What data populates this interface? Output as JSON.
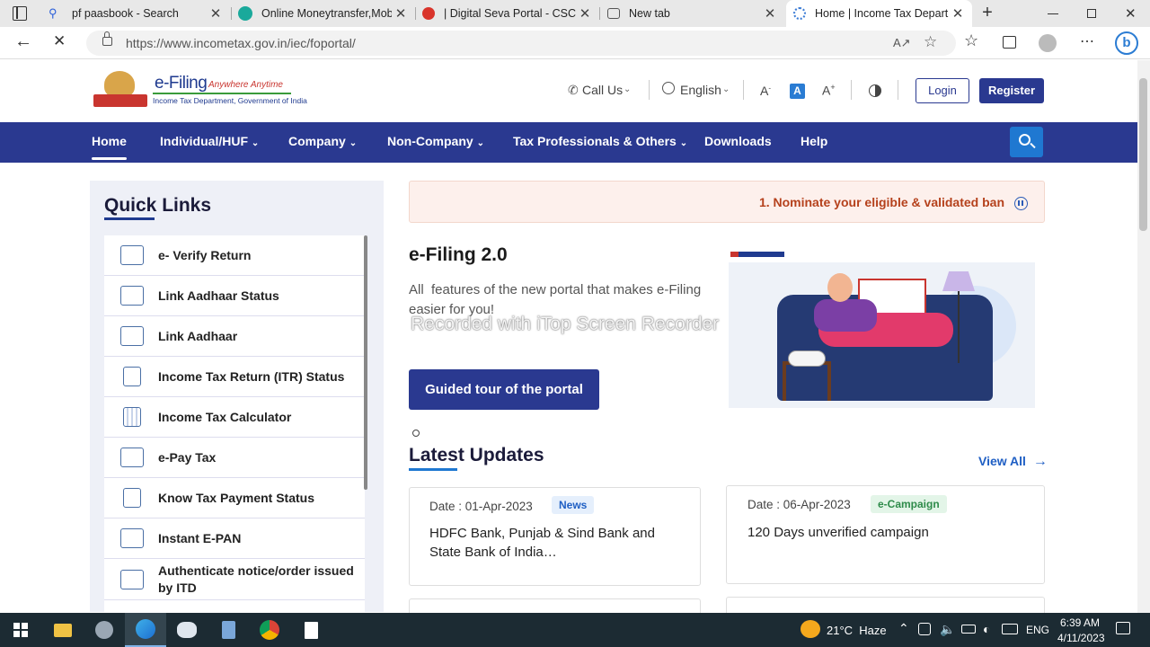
{
  "browser": {
    "tabs": [
      {
        "title": "pf paasbook - Search",
        "favicon_color": "#2b5fd9"
      },
      {
        "title": "Online Moneytransfer,Mobile",
        "favicon_color": "#1aa99b"
      },
      {
        "title": "| Digital Seva Portal - CSC e-G",
        "favicon_color": "#d9342b"
      },
      {
        "title": "New tab",
        "favicon_color": "#555555"
      },
      {
        "title": "Home | Income Tax Departme",
        "favicon_color": "#3a7bd5"
      }
    ],
    "url": "https://www.incometax.gov.in/iec/foportal/",
    "reader_icon": "read-aloud-icon"
  },
  "header": {
    "logo_title": "e-Filing",
    "logo_tagline": "Anywhere Anytime",
    "logo_subtitle": "Income Tax Department, Government of India",
    "call_us": "Call Us",
    "language": "English",
    "login": "Login",
    "register": "Register"
  },
  "nav": {
    "items": [
      "Home",
      "Individual/HUF",
      "Company",
      "Non-Company",
      "Tax Professionals & Others",
      "Downloads",
      "Help"
    ]
  },
  "quick_links": {
    "title": "Quick Links",
    "items": [
      "e- Verify Return",
      "Link Aadhaar Status",
      "Link Aadhaar",
      "Income Tax Return (ITR) Status",
      "Income Tax Calculator",
      "e-Pay Tax",
      "Know Tax Payment Status",
      "Instant E-PAN",
      "Authenticate notice/order issued by ITD"
    ]
  },
  "ticker": {
    "text": "1. Nominate your eligible & validated ban"
  },
  "hero": {
    "title": "e-Filing 2.0",
    "text": "All  features of the new portal that makes e-Filing easier for you!",
    "button": "Guided tour of the portal",
    "watermark": "Recorded with iTop Screen Recorder"
  },
  "updates": {
    "title": "Latest Updates",
    "view_all": "View All",
    "cards": [
      {
        "date": "Date : 01-Apr-2023",
        "badge": "News",
        "text": "HDFC Bank, Punjab & Sind Bank and State Bank of India…"
      },
      {
        "date": "Date : 06-Apr-2023",
        "badge": "e-Campaign",
        "text": "120 Days unverified campaign"
      }
    ]
  },
  "taskbar": {
    "weather": "21°C  Haze",
    "lang": "ENG",
    "time": "6:39 AM",
    "date": "4/11/2023"
  }
}
